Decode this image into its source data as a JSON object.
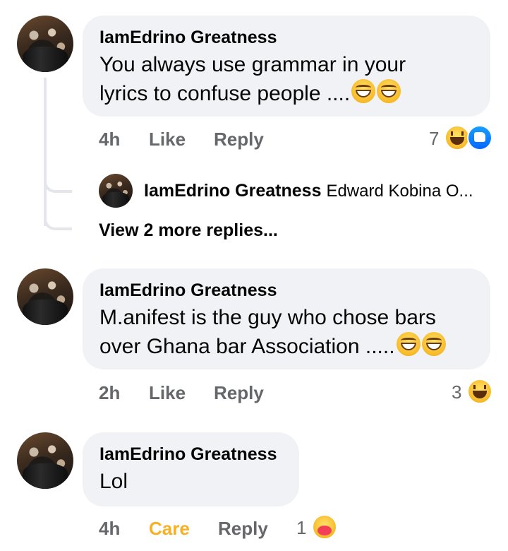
{
  "comments": [
    {
      "author": "IamEdrino Greatness",
      "text_line1": "You always use grammar in your",
      "text_line2": "lyrics to confuse people ....",
      "emoji": "grinning-squinting-face x2",
      "time": "4h",
      "action1": "Like",
      "action2": "Reply",
      "reaction_count": "7",
      "reactions": [
        "haha",
        "like"
      ]
    },
    {
      "author": "IamEdrino Greatness",
      "text_line1": "M.anifest is the guy who chose bars",
      "text_line2": "over Ghana bar Association .....",
      "emoji": "grinning-squinting-face x2",
      "time": "2h",
      "action1": "Like",
      "action2": "Reply",
      "reaction_count": "3",
      "reactions": [
        "haha"
      ]
    },
    {
      "author": "IamEdrino Greatness",
      "text_line1": "Lol",
      "time": "4h",
      "action1": "Care",
      "action2": "Reply",
      "reaction_count": "1",
      "reactions": [
        "care"
      ]
    }
  ],
  "reply_preview": {
    "author": "IamEdrino Greatness",
    "snippet": "Edward Kobina O..."
  },
  "view_more": "View 2 more replies...",
  "colors": {
    "bubble": "#f0f2f5",
    "meta": "#65676b",
    "care": "#f7b125",
    "like_blue": "#0866ff"
  }
}
